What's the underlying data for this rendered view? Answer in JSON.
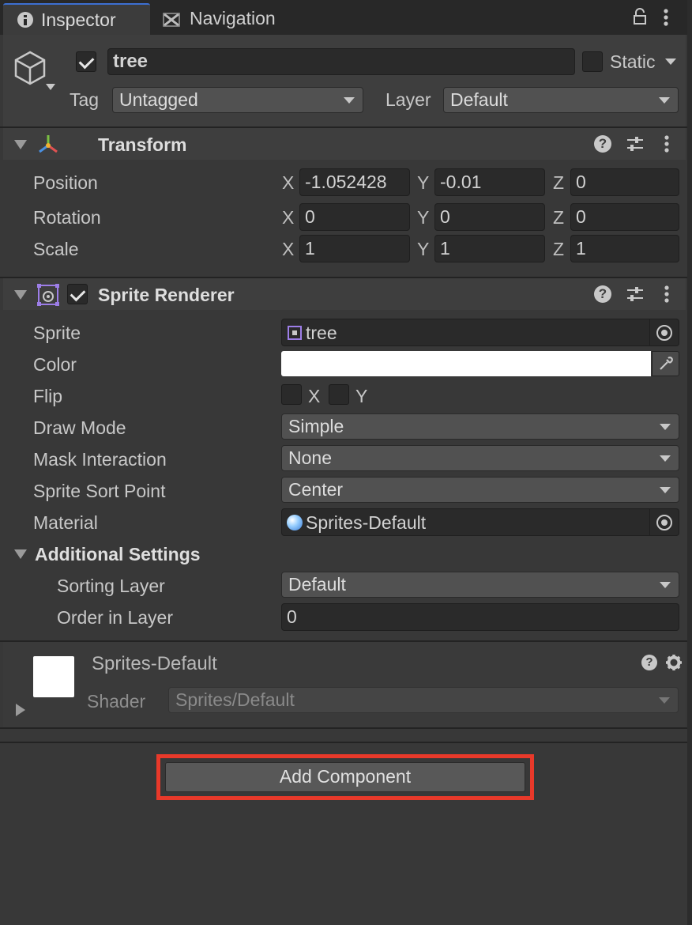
{
  "tabs": [
    {
      "label": "Inspector",
      "icon": "info-icon",
      "active": true
    },
    {
      "label": "Navigation",
      "icon": "navigation-icon",
      "active": false
    }
  ],
  "gameobject": {
    "active": true,
    "name": "tree",
    "static_label": "Static",
    "static_checked": false,
    "tag_label": "Tag",
    "tag_value": "Untagged",
    "layer_label": "Layer",
    "layer_value": "Default"
  },
  "transform": {
    "title": "Transform",
    "rows": [
      {
        "label": "Position",
        "x": "-1.052428",
        "y": "-0.01",
        "z": "0"
      },
      {
        "label": "Rotation",
        "x": "0",
        "y": "0",
        "z": "0"
      },
      {
        "label": "Scale",
        "x": "1",
        "y": "1",
        "z": "1"
      }
    ],
    "axes": {
      "x": "X",
      "y": "Y",
      "z": "Z"
    }
  },
  "sprite_renderer": {
    "title": "Sprite Renderer",
    "enabled": true,
    "sprite_label": "Sprite",
    "sprite_value": "tree",
    "color_label": "Color",
    "color_value": "#ffffff",
    "flip_label": "Flip",
    "flip_x_label": "X",
    "flip_y_label": "Y",
    "draw_mode_label": "Draw Mode",
    "draw_mode_value": "Simple",
    "mask_label": "Mask Interaction",
    "mask_value": "None",
    "sort_point_label": "Sprite Sort Point",
    "sort_point_value": "Center",
    "material_label": "Material",
    "material_value": "Sprites-Default",
    "additional_label": "Additional Settings",
    "sorting_layer_label": "Sorting Layer",
    "sorting_layer_value": "Default",
    "order_label": "Order in Layer",
    "order_value": "0"
  },
  "material": {
    "name": "Sprites-Default",
    "shader_label": "Shader",
    "shader_value": "Sprites/Default"
  },
  "add_component_label": "Add Component",
  "colors": {
    "panel_bg": "#383838",
    "header_bg": "#3e3e3e",
    "highlight": "#e8392a",
    "accent": "#3c6fd1"
  }
}
